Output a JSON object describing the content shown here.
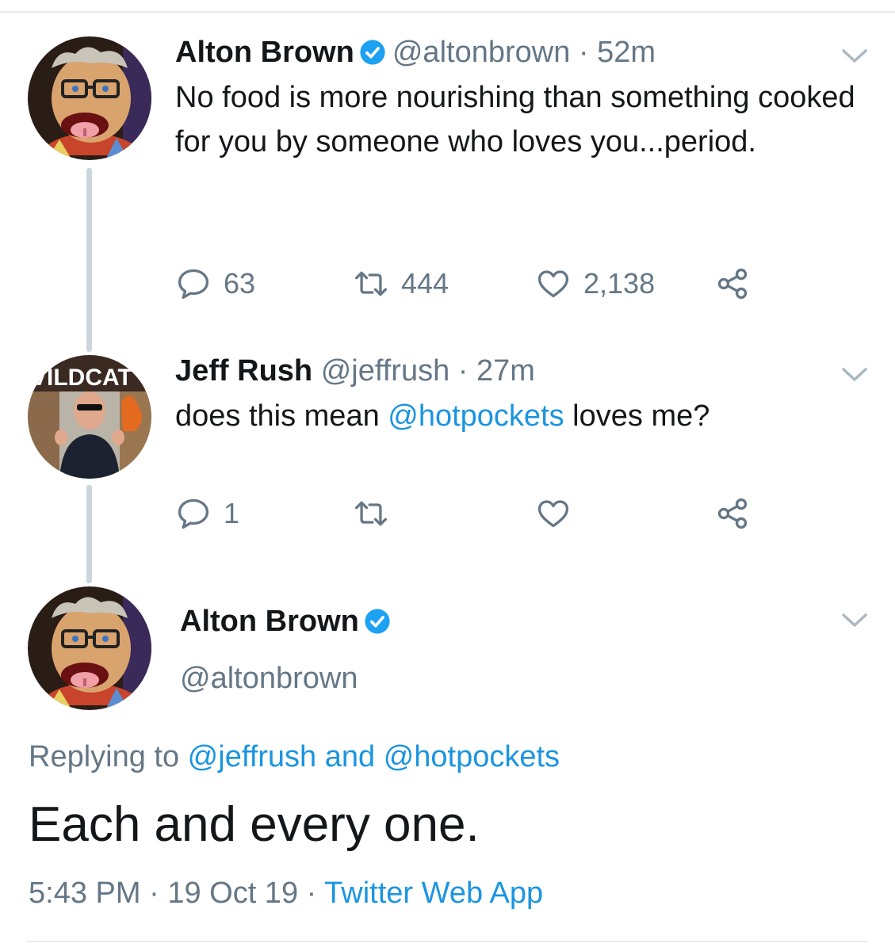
{
  "tweets": [
    {
      "name": "Alton Brown",
      "handle": "@altonbrown",
      "separator": "·",
      "time": "52m",
      "text": "No food is more nourishing than something cooked for you by someone who loves you...period.",
      "replies": "63",
      "retweets": "444",
      "likes": "2,138",
      "avatar_icon": "puppet-avatar"
    },
    {
      "name": "Jeff Rush",
      "handle": "@jeffrush",
      "separator": "·",
      "time": "27m",
      "text_before": "does this mean ",
      "mention": "@hotpockets",
      "text_after": " loves me?",
      "replies": "1",
      "avatar_banner": "VILDCAT",
      "avatar_icon": "person-avatar"
    }
  ],
  "reply": {
    "name": "Alton Brown",
    "handle": "@altonbrown",
    "replying_prefix": "Replying to ",
    "replying_users": "@jeffrush and @hotpockets",
    "text": "Each and every one.",
    "time": "5:43 PM",
    "separator": "·",
    "date": "19 Oct 19",
    "source": "Twitter Web App"
  },
  "colors": {
    "accent": "#1b95e0",
    "muted": "#657786",
    "text": "#14171a",
    "verified": "#1da1f2"
  }
}
